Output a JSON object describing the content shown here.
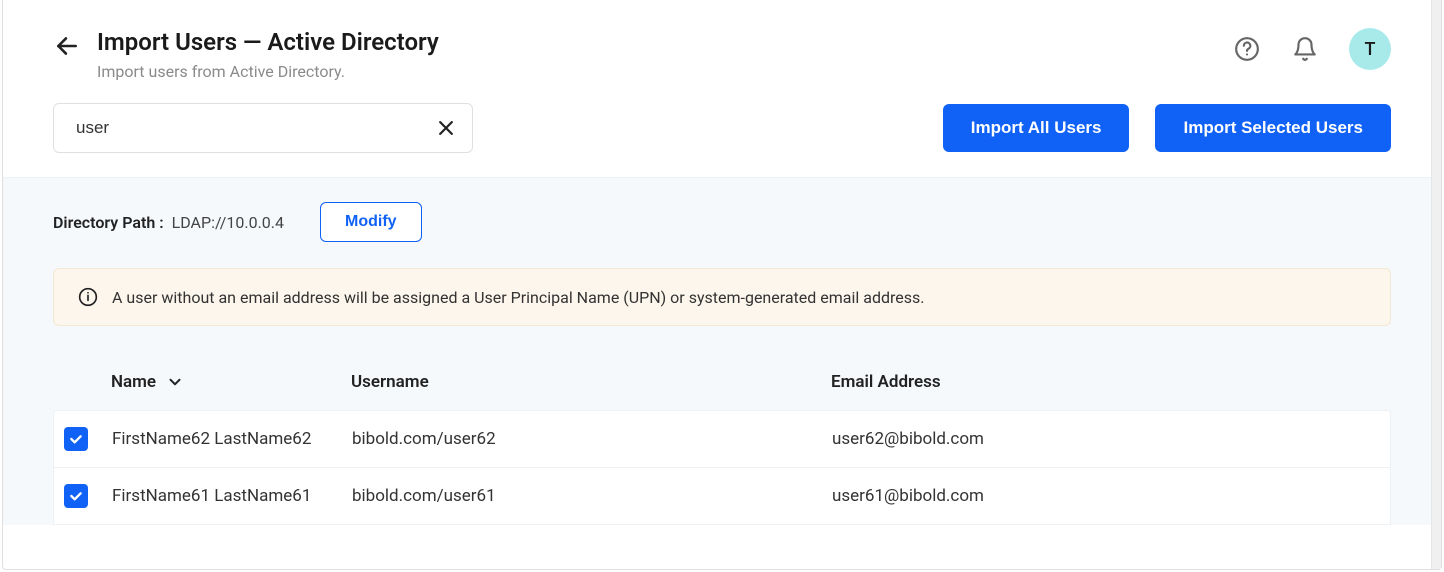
{
  "header": {
    "title": "Import Users — Active Directory",
    "subtitle": "Import users from Active Directory.",
    "avatar_initial": "T"
  },
  "toolbar": {
    "search_value": "user",
    "import_all_label": "Import All Users",
    "import_selected_label": "Import Selected Users"
  },
  "directory": {
    "label": "Directory Path :",
    "value": "LDAP://10.0.0.4",
    "modify_label": "Modify"
  },
  "notice": {
    "text": "A user without an email address will be assigned a User Principal Name (UPN) or system-generated email address."
  },
  "table": {
    "columns": {
      "name": "Name",
      "username": "Username",
      "email": "Email Address"
    },
    "rows": [
      {
        "checked": true,
        "name": "FirstName62 LastName62",
        "username": "bibold.com/user62",
        "email": "user62@bibold.com"
      },
      {
        "checked": true,
        "name": "FirstName61 LastName61",
        "username": "bibold.com/user61",
        "email": "user61@bibold.com"
      }
    ]
  }
}
